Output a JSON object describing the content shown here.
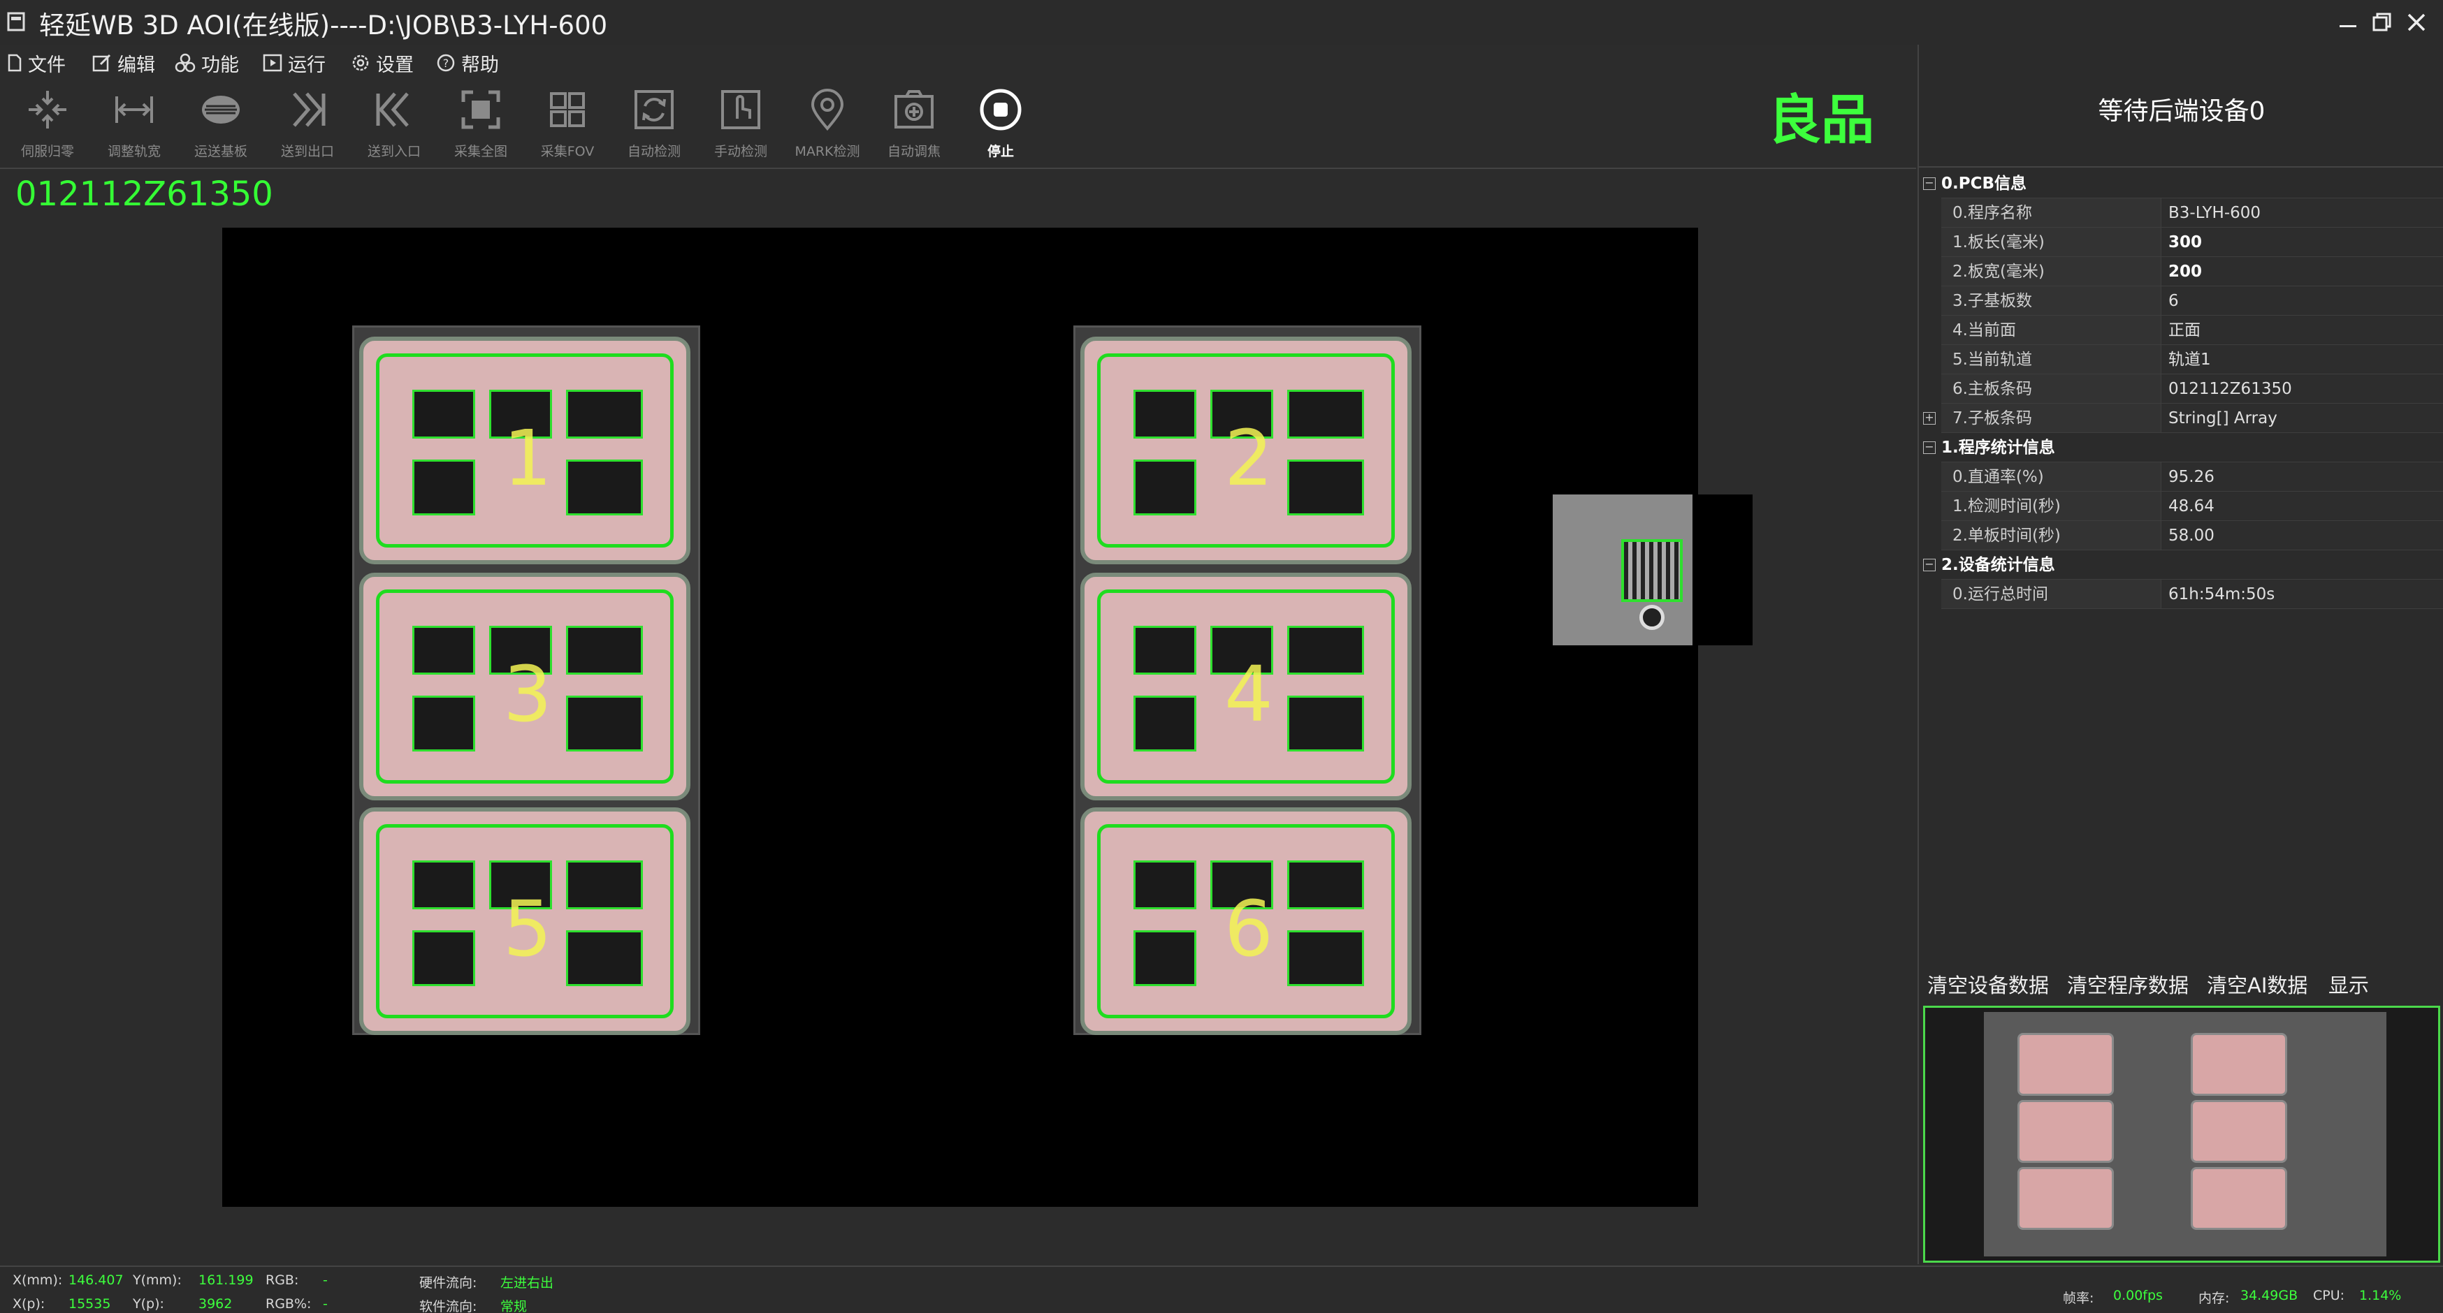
{
  "window": {
    "title": "轻延WB 3D AOI(在线版)----D:\\JOB\\B3-LYH-600"
  },
  "menu": [
    {
      "label": "文件",
      "icon": "file-icon"
    },
    {
      "label": "编辑",
      "icon": "edit-icon"
    },
    {
      "label": "功能",
      "icon": "function-icon"
    },
    {
      "label": "运行",
      "icon": "run-icon"
    },
    {
      "label": "设置",
      "icon": "settings-icon"
    },
    {
      "label": "帮助",
      "icon": "help-icon"
    }
  ],
  "toolbar": [
    {
      "label": "伺服归零",
      "icon": "servo-home-icon",
      "enabled": false
    },
    {
      "label": "调整轨宽",
      "icon": "adjust-rail-width-icon",
      "enabled": false
    },
    {
      "label": "运送基板",
      "icon": "transport-board-icon",
      "enabled": false
    },
    {
      "label": "送到出口",
      "icon": "send-to-exit-icon",
      "enabled": false
    },
    {
      "label": "送到入口",
      "icon": "send-to-entrance-icon",
      "enabled": false
    },
    {
      "label": "采集全图",
      "icon": "capture-full-icon",
      "enabled": false
    },
    {
      "label": "采集FOV",
      "icon": "capture-fov-icon",
      "enabled": false
    },
    {
      "label": "自动检测",
      "icon": "auto-inspect-icon",
      "enabled": false
    },
    {
      "label": "手动检测",
      "icon": "manual-inspect-icon",
      "enabled": false
    },
    {
      "label": "MARK检测",
      "icon": "mark-inspect-icon",
      "enabled": false
    },
    {
      "label": "自动调焦",
      "icon": "auto-focus-icon",
      "enabled": false
    },
    {
      "label": "停止",
      "icon": "stop-icon",
      "enabled": true
    }
  ],
  "result": "良品",
  "barcode": "012112Z61350",
  "subboard_numbers": [
    "1",
    "2",
    "3",
    "4",
    "5",
    "6"
  ],
  "right_panel": {
    "status": "等待后端设备0",
    "groups": [
      {
        "title": "0.PCB信息",
        "expanded": true,
        "rows": [
          {
            "key": "0.程序名称",
            "value": "B3-LYH-600"
          },
          {
            "key": "1.板长(毫米)",
            "value": "300"
          },
          {
            "key": "2.板宽(毫米)",
            "value": "200"
          },
          {
            "key": "3.子基板数",
            "value": "6"
          },
          {
            "key": "4.当前面",
            "value": "正面"
          },
          {
            "key": "5.当前轨道",
            "value": "轨道1"
          },
          {
            "key": "6.主板条码",
            "value": "012112Z61350"
          },
          {
            "key": "7.子板条码",
            "value": "String[] Array"
          }
        ]
      },
      {
        "title": "1.程序统计信息",
        "expanded": true,
        "rows": [
          {
            "key": "0.直通率(%)",
            "value": "95.26"
          },
          {
            "key": "1.检测时间(秒)",
            "value": "48.64"
          },
          {
            "key": "2.单板时间(秒)",
            "value": "58.00"
          }
        ]
      },
      {
        "title": "2.设备统计信息",
        "expanded": true,
        "rows": [
          {
            "key": "0.运行总时间",
            "value": "61h:54m:50s"
          }
        ]
      }
    ],
    "buttons": [
      "清空设备数据",
      "清空程序数据",
      "清空AI数据",
      "显示"
    ]
  },
  "statusbar": {
    "x_mm_label": "X(mm):",
    "x_mm": "146.407",
    "y_mm_label": "Y(mm):",
    "y_mm": "161.199",
    "rgb_label": "RGB:",
    "rgb": "-",
    "x_p_label": "X(p):",
    "x_p": "15535",
    "y_p_label": "Y(p):",
    "y_p": "3962",
    "rgb_pct_label": "RGB%:",
    "rgb_pct": "-",
    "hw_dir_label": "硬件流向:",
    "hw_dir": "左进右出",
    "sw_dir_label": "软件流向:",
    "sw_dir": "常规",
    "fps_label": "帧率:",
    "fps": "0.00fps",
    "mem_label": "内存:",
    "mem": "34.49GB",
    "cpu_label": "CPU:",
    "cpu": "1.14%"
  },
  "colors": {
    "accent_green": "#3dff3d",
    "background": "#2c2c2c",
    "canvas": "#000000"
  }
}
